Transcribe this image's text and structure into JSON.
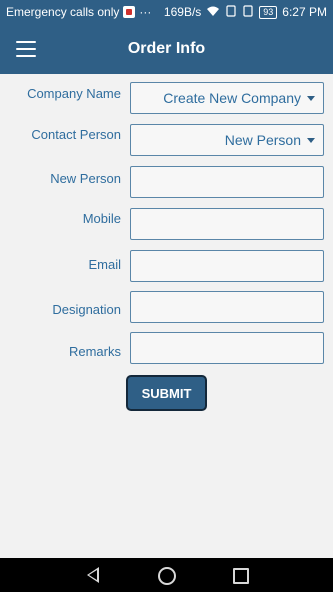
{
  "status_bar": {
    "carrier_text": "Emergency calls only",
    "dots": "···",
    "network_speed": "169B/s",
    "battery": "93",
    "time": "6:27 PM"
  },
  "app_bar": {
    "title": "Order Info",
    "menu_icon": "hamburger-menu-icon"
  },
  "form": {
    "company_name": {
      "label": "Company Name",
      "selected": "Create New Company"
    },
    "contact_person": {
      "label": "Contact Person",
      "selected": "New Person"
    },
    "new_person": {
      "label": "New Person",
      "value": ""
    },
    "mobile": {
      "label": "Mobile",
      "value": ""
    },
    "email": {
      "label": "Email",
      "value": ""
    },
    "designation": {
      "label": "Designation",
      "value": ""
    },
    "remarks": {
      "label": "Remarks",
      "value": ""
    },
    "submit_label": "SUBMIT"
  },
  "colors": {
    "primary": "#2f5f86",
    "label_text": "#2f6d9e",
    "background": "#f2f2f2"
  }
}
